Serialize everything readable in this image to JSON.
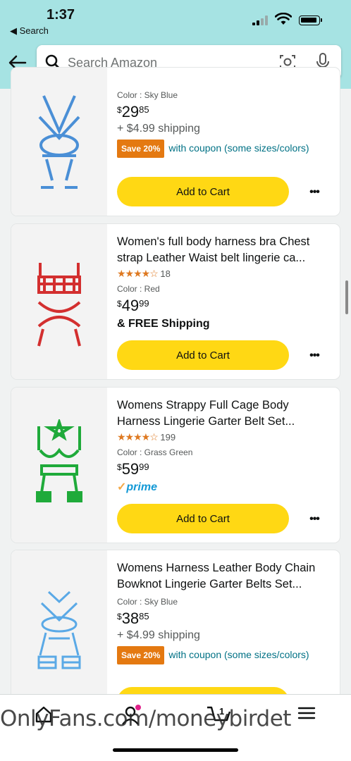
{
  "status_bar": {
    "time": "1:37",
    "back_label": "◀ Search"
  },
  "search": {
    "placeholder": "Search Amazon"
  },
  "products": [
    {
      "color": "Color : Sky Blue",
      "price_whole": "29",
      "price_cents": "85",
      "shipping": "+ $4.99 shipping",
      "coupon_badge": "Save 20%",
      "coupon_text": "with coupon (some sizes/colors)",
      "cart_label": "Add to Cart",
      "image_color": "#4a8fd6"
    },
    {
      "title": "Women's full body harness bra Chest strap Leather Waist belt lingerie ca...",
      "stars": "★★★★☆",
      "rating_count": "18",
      "color": "Color : Red",
      "price_whole": "49",
      "price_cents": "99",
      "shipping_free": "& FREE Shipping",
      "cart_label": "Add to Cart",
      "image_color": "#d32f2f"
    },
    {
      "title": "Womens Strappy Full Cage Body Harness Lingerie Garter Belt Set...",
      "stars": "★★★★☆",
      "rating_count": "199",
      "color": "Color : Grass Green",
      "price_whole": "59",
      "price_cents": "99",
      "prime": "prime",
      "cart_label": "Add to Cart",
      "image_color": "#1faa3a"
    },
    {
      "title": "Womens Harness Leather Body Chain Bowknot Lingerie Garter Belts Set...",
      "color": "Color : Sky Blue",
      "price_whole": "38",
      "price_cents": "85",
      "shipping": "+ $4.99 shipping",
      "coupon_badge": "Save 20%",
      "coupon_text": "with coupon (some sizes/colors)",
      "cart_label": "Add to Cart",
      "image_color": "#5aa9e6"
    }
  ],
  "more_label": "•••",
  "currency": "$",
  "watermark": "OnlyFans.com/moneybirdet",
  "cart_count": "1"
}
